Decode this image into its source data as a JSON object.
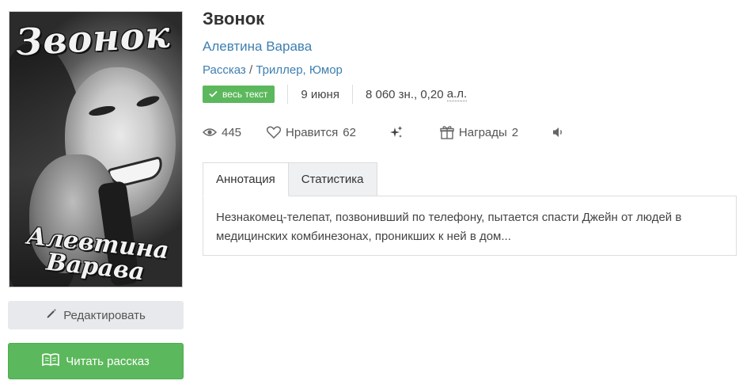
{
  "cover": {
    "title_art": "Звонок",
    "author_art": "Алевтина Варава"
  },
  "buttons": {
    "edit_label": "Редактировать",
    "read_label": "Читать рассказ"
  },
  "book": {
    "title": "Звонок",
    "author": "Алевтина Варава",
    "form": "Рассказ",
    "genre_separator": "/",
    "genres": [
      "Триллер",
      "Юмор"
    ],
    "genre_comma": ","
  },
  "meta": {
    "badge": "весь текст",
    "date": "9 июня",
    "size_chars": "8 060 зн., 0,20",
    "size_unit": "а.л."
  },
  "stats": {
    "views": "445",
    "likes_label": "Нравится",
    "likes": "62",
    "awards_label": "Награды",
    "awards": "2"
  },
  "tabs": [
    {
      "label": "Аннотация",
      "active": true
    },
    {
      "label": "Статистика",
      "active": false
    }
  ],
  "annotation": "Незнакомец-телепат, позвонивший по телефону, пытается спасти Джейн от людей в медицинских комбинезонах, проникших к ней в дом...",
  "colors": {
    "link": "#3d7fb0",
    "accent_green": "#5cb85c",
    "button_grey": "#e7e9ec"
  },
  "icons": [
    "eye-icon",
    "heart-icon",
    "sparkles-icon",
    "gift-icon",
    "speaker-icon",
    "pencil-icon",
    "book-icon",
    "check-icon"
  ]
}
